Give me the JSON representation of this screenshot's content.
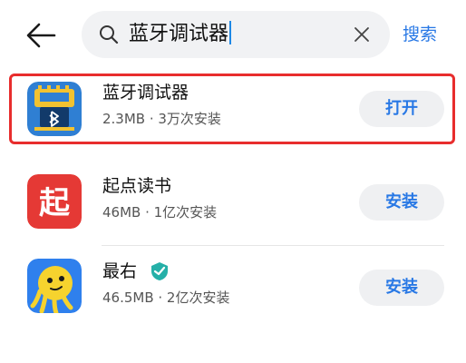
{
  "search": {
    "query": "蓝牙调试器",
    "action_label": "搜索"
  },
  "results": [
    {
      "name": "蓝牙调试器",
      "meta": "2.3MB · 3万次安装",
      "button": "打开",
      "icon": "bluetooth-debugger-icon"
    },
    {
      "name": "起点读书",
      "meta": "46MB · 1亿次安装",
      "button": "安装",
      "icon": "qidian-reader-icon"
    },
    {
      "name": "最右",
      "meta": "46.5MB · 2亿次安装",
      "button": "安装",
      "icon": "zuiyou-icon"
    }
  ],
  "colors": {
    "accent": "#2878e5",
    "highlight": "#e82d2d",
    "qidian_red": "#e53935",
    "zuiyou_blue": "#2f80ed",
    "zuiyou_yellow": "#f6d32e"
  }
}
